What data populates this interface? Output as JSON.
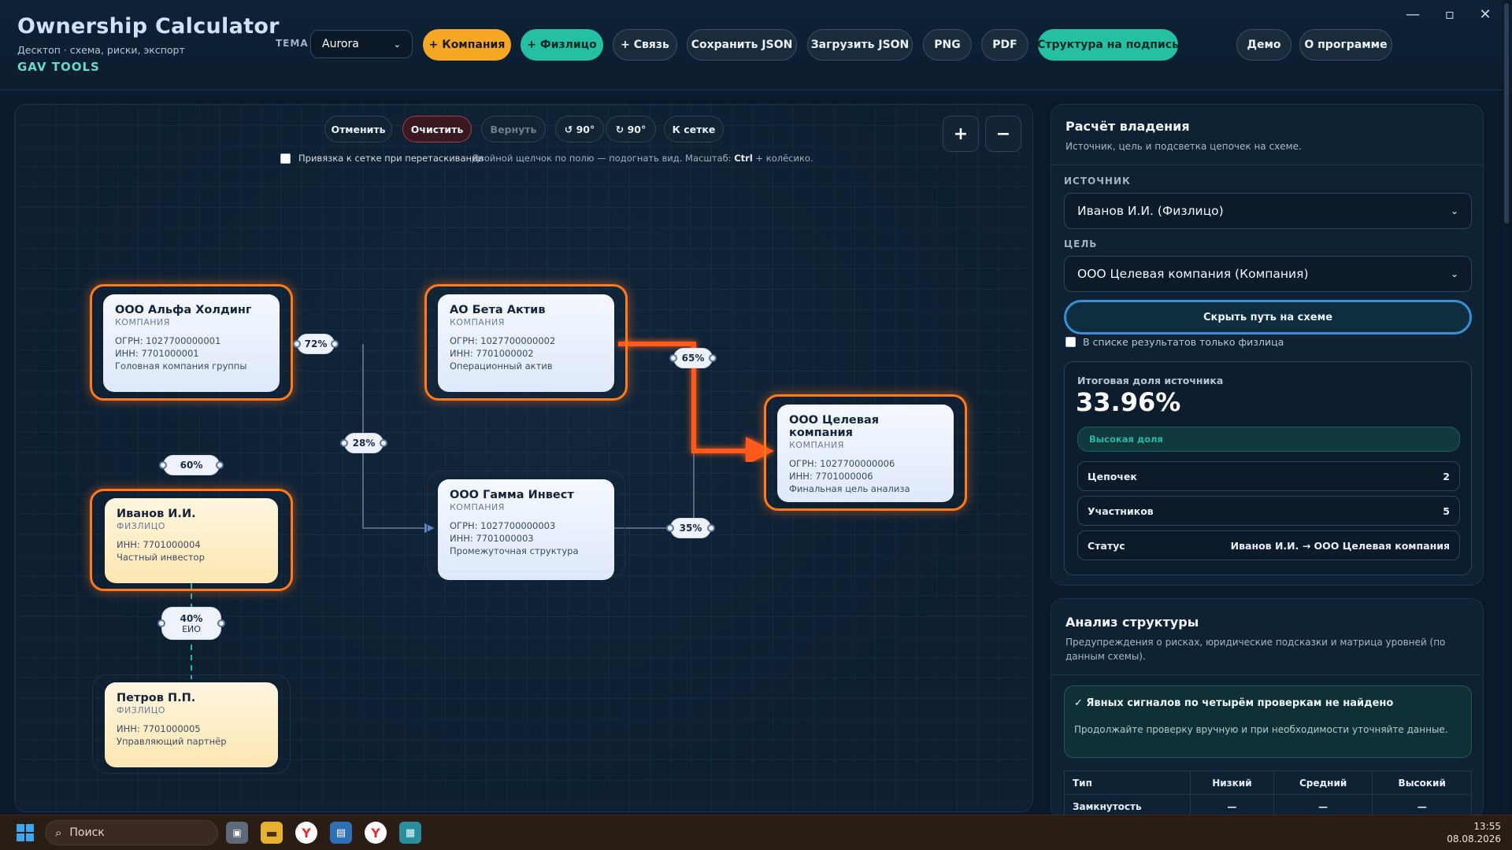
{
  "app": {
    "title": "Ownership Calculator",
    "subtitle": "Десктоп · схема, риски, экспорт",
    "brand": "GAV TOOLS"
  },
  "toolbar": {
    "theme_label": "ТЕМА",
    "theme_value": "Aurora",
    "add_company": "+ Компания",
    "add_person": "+ Физлицо",
    "add_link": "+ Связь",
    "save_json": "Сохранить JSON",
    "load_json": "Загрузить JSON",
    "png": "PNG",
    "pdf": "PDF",
    "structure_sign": "Структура на подпись",
    "demo": "Демо",
    "about": "О программе"
  },
  "window": {
    "minimize": "—",
    "maximize": "▫",
    "close": "✕"
  },
  "canvas": {
    "undo": "Отменить",
    "clear": "Очистить",
    "redo": "Вернуть",
    "rot_left": "↺ 90°",
    "rot_right": "↻ 90°",
    "to_grid": "К сетке",
    "zoom_in": "+",
    "zoom_out": "−",
    "snap_label": "Привязка к сетке при перетаскивании",
    "hint_pre": "Двойной щелчок по полю — подогнать вид. Масштаб: ",
    "hint_key": "Ctrl",
    "hint_post": " + колёсико."
  },
  "nodes": {
    "alfa": {
      "name": "ООО Альфа Холдинг",
      "type": "КОМПАНИЯ",
      "ogrn": "ОГРН: 1027700000001",
      "inn": "ИНН: 7701000001",
      "note": "Головная компания группы"
    },
    "beta": {
      "name": "АО Бета Актив",
      "type": "КОМПАНИЯ",
      "ogrn": "ОГРН: 1027700000002",
      "inn": "ИНН: 7701000002",
      "note": "Операционный актив"
    },
    "gamma": {
      "name": "ООО Гамма Инвест",
      "type": "КОМПАНИЯ",
      "ogrn": "ОГРН: 1027700000003",
      "inn": "ИНН: 7701000003",
      "note": "Промежуточная структура"
    },
    "target": {
      "name": "ООО Целевая компания",
      "type": "КОМПАНИЯ",
      "ogrn": "ОГРН: 1027700000006",
      "inn": "ИНН: 7701000006",
      "note": "Финальная цель анализа"
    },
    "ivanov": {
      "name": "Иванов И.И.",
      "type": "ФИЗЛИЦО",
      "inn": "ИНН: 7701000004",
      "note": "Частный инвестор"
    },
    "petrov": {
      "name": "Петров П.П.",
      "type": "ФИЗЛИЦО",
      "inn": "ИНН: 7701000005",
      "note": "Управляющий партнёр"
    }
  },
  "edges": {
    "alfa_beta": "72%",
    "beta_target": "65%",
    "alfa_gamma": "28%",
    "ivanov_alfa": "60%",
    "gamma_target": "35%",
    "petrov_ivanov": "40%",
    "petrov_ivanov_sub": "ЕИО"
  },
  "calc": {
    "title": "Расчёт владения",
    "subtitle": "Источник, цель и подсветка цепочек на схеме.",
    "source_label": "ИСТОЧНИК",
    "source_value": "Иванов И.И. (Физлицо)",
    "target_label": "ЦЕЛЬ",
    "target_value": "ООО Целевая компания (Компания)",
    "hide_path": "Скрыть путь на схеме",
    "only_persons": "В списке результатов только физлица",
    "result_label": "Итоговая доля источника",
    "result_value": "33.96%",
    "level": "Высокая доля",
    "chains_label": "Цепочек",
    "chains_value": "2",
    "members_label": "Участников",
    "members_value": "5",
    "status_label": "Статус",
    "status_value": "Иванов И.И. → ООО Целевая компания"
  },
  "analysis": {
    "title": "Анализ структуры",
    "subtitle": "Предупреждения о рисках, юридические подсказки и матрица уровней (по данным схемы).",
    "ok_title": "✓ Явных сигналов по четырём проверкам не найдено",
    "ok_text": "Продолжайте проверку вручную и при необходимости уточняйте данные.",
    "table_headers": [
      "Тип",
      "Низкий",
      "Средний",
      "Высокий"
    ],
    "table_rows": [
      [
        "Замкнутость",
        "—",
        "—",
        "—"
      ]
    ]
  },
  "taskbar": {
    "search": "Поиск",
    "time": "13:55",
    "date": "08.08.2026"
  },
  "colors": {
    "accent_orange": "#ff7a1a",
    "teal": "#25bfa3",
    "amber": "#f4a722"
  }
}
